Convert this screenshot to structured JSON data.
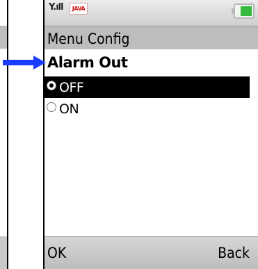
{
  "status_bar": {
    "signal_icon": "signal-strength-icon",
    "java_logo_text": "JAVA",
    "battery_icon": "battery-icon",
    "battery_color": "#35b93f"
  },
  "title_bar": {
    "title": "Menu Config"
  },
  "content": {
    "header": "Alarm Out",
    "options": [
      {
        "label": "OFF",
        "selected": true
      },
      {
        "label": "ON",
        "selected": false
      }
    ]
  },
  "softkeys": {
    "left": "OK",
    "right": "Back"
  },
  "annotation": {
    "arrow_icon": "right-arrow-icon",
    "arrow_color": "#1a3cff"
  },
  "colors": {
    "title_bar": "#bdbdbd",
    "selection": "#000000",
    "softkey_bar": "#c8c8c8"
  }
}
